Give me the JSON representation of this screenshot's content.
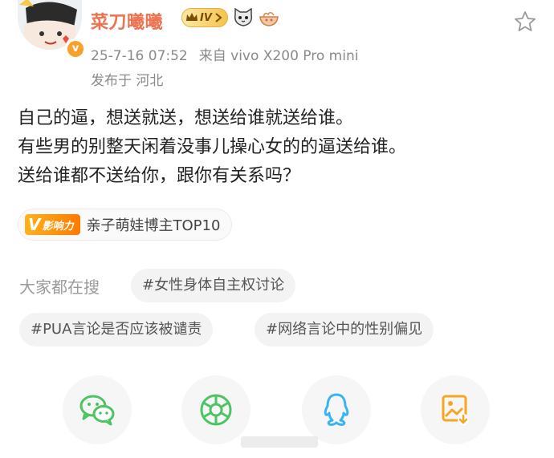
{
  "header": {
    "username": "菜刀曦曦",
    "level_badge": "IV",
    "timestamp": "25-7-16 07:52",
    "source": "来自 vivo X200 Pro mini",
    "location": "发布于 河北",
    "verified_mark": "v"
  },
  "post": {
    "lines": [
      "自己的逼，想送就送，想送给谁就送给谁。",
      "有些男的别整天闲着没事儿操心女的的逼送给谁。",
      "送给谁都不送给你，跟你有关系吗？"
    ]
  },
  "influence": {
    "logo_text": "影响力",
    "logo_v": "V",
    "label": "亲子萌娃博主TOP10"
  },
  "search": {
    "label": "大家都在搜",
    "chips": [
      "#女性身体自主权讨论",
      "#PUA言论是否应该被谴责",
      "#网络言论中的性别偏见"
    ]
  },
  "share": {
    "icons": [
      "wechat-icon",
      "moments-icon",
      "qq-icon",
      "save-image-icon"
    ]
  },
  "colors": {
    "username": "#eb7350",
    "accent_green": "#4cc462",
    "qq_blue": "#3bb3f2",
    "save_orange": "#f5a623"
  }
}
